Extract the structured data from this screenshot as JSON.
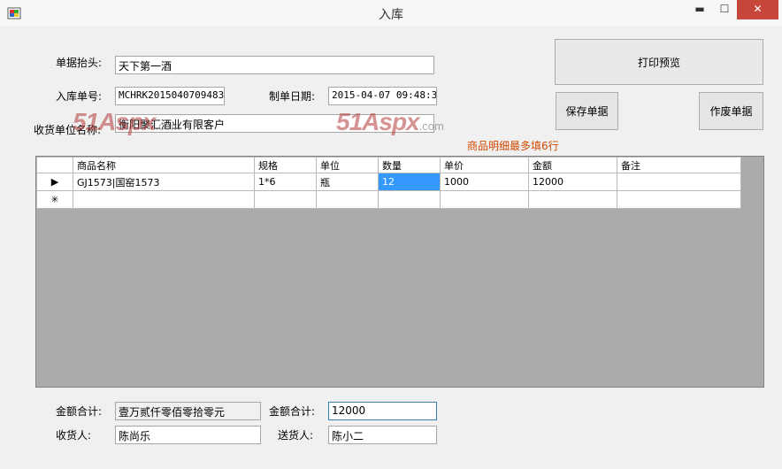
{
  "window": {
    "title": "入库",
    "min": "▬",
    "max": "☐",
    "close": "✕"
  },
  "form": {
    "doc_header_label": "单据抬头:",
    "doc_header_value": "天下第一酒",
    "doc_no_label": "入库单号:",
    "doc_no_value": "MCHRK20150407094831",
    "date_label": "制单日期:",
    "date_value": "2015-04-07 09:48:31",
    "receiver_unit_label": "收货单位名称:",
    "receiver_unit_value": "衡阳聚汇酒业有限客户"
  },
  "buttons": {
    "print_preview": "打印预览",
    "save": "保存单据",
    "void": "作废单据"
  },
  "note": "商品明细最多填6行",
  "watermark": {
    "text": "51Aspx",
    "suffix": ".com"
  },
  "grid": {
    "columns": [
      "商品名称",
      "规格",
      "单位",
      "数量",
      "单价",
      "金额",
      "备注"
    ],
    "rows": [
      {
        "marker": "▶",
        "cells": [
          "GJ1573|国窑1573",
          "1*6",
          "瓶",
          "12",
          "1000",
          "12000",
          ""
        ]
      },
      {
        "marker": "✳",
        "cells": [
          "",
          "",
          "",
          "",
          "",
          "",
          ""
        ]
      }
    ]
  },
  "footer": {
    "amount_cn_label": "金额合计:",
    "amount_cn_value": "壹万贰仟零佰零拾零元",
    "amount_label": "金额合计:",
    "amount_value": "12000",
    "receiver_label": "收货人:",
    "receiver_value": "陈尚乐",
    "sender_label": "送货人:",
    "sender_value": "陈小二"
  }
}
